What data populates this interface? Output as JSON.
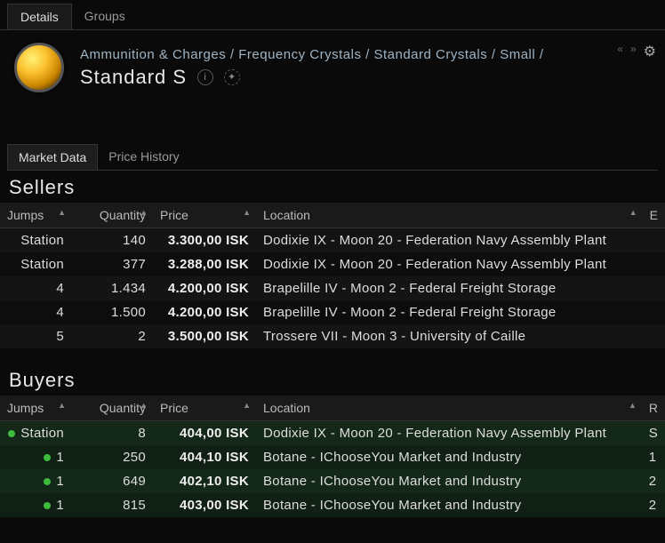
{
  "topTabs": {
    "details": "Details",
    "groups": "Groups"
  },
  "breadcrumb": [
    "Ammunition & Charges",
    "Frequency Crystals",
    "Standard Crystals",
    "Small"
  ],
  "itemName": "Standard S",
  "nav": {
    "back": "«",
    "fwd": "»"
  },
  "dataTabs": {
    "market": "Market Data",
    "history": "Price History"
  },
  "sections": {
    "sellers": "Sellers",
    "buyers": "Buyers"
  },
  "columns": {
    "jumps": "Jumps",
    "quantity": "Quantity",
    "price": "Price",
    "location": "Location",
    "ext": "E",
    "extR": "R"
  },
  "sellers": [
    {
      "jumps": "Station",
      "qty": "140",
      "price": "3.300,00 ISK",
      "loc": "Dodixie IX - Moon 20 - Federation Navy Assembly Plant"
    },
    {
      "jumps": "Station",
      "qty": "377",
      "price": "3.288,00 ISK",
      "loc": "Dodixie IX - Moon 20 - Federation Navy Assembly Plant"
    },
    {
      "jumps": "4",
      "qty": "1.434",
      "price": "4.200,00 ISK",
      "loc": "Brapelille IV - Moon 2 - Federal Freight Storage"
    },
    {
      "jumps": "4",
      "qty": "1.500",
      "price": "4.200,00 ISK",
      "loc": "Brapelille IV - Moon 2 - Federal Freight Storage"
    },
    {
      "jumps": "5",
      "qty": "2",
      "price": "3.500,00 ISK",
      "loc": "Trossere VII - Moon 3 - University of Caille"
    }
  ],
  "buyers": [
    {
      "jumps": "Station",
      "qty": "8",
      "price": "404,00 ISK",
      "loc": "Dodixie IX - Moon 20 - Federation Navy Assembly Plant",
      "ext": "S"
    },
    {
      "jumps": "1",
      "qty": "250",
      "price": "404,10 ISK",
      "loc": "Botane - IChooseYou Market and Industry",
      "ext": "1"
    },
    {
      "jumps": "1",
      "qty": "649",
      "price": "402,10 ISK",
      "loc": "Botane - IChooseYou Market and Industry",
      "ext": "2"
    },
    {
      "jumps": "1",
      "qty": "815",
      "price": "403,00 ISK",
      "loc": "Botane - IChooseYou Market and Industry",
      "ext": "2"
    }
  ]
}
